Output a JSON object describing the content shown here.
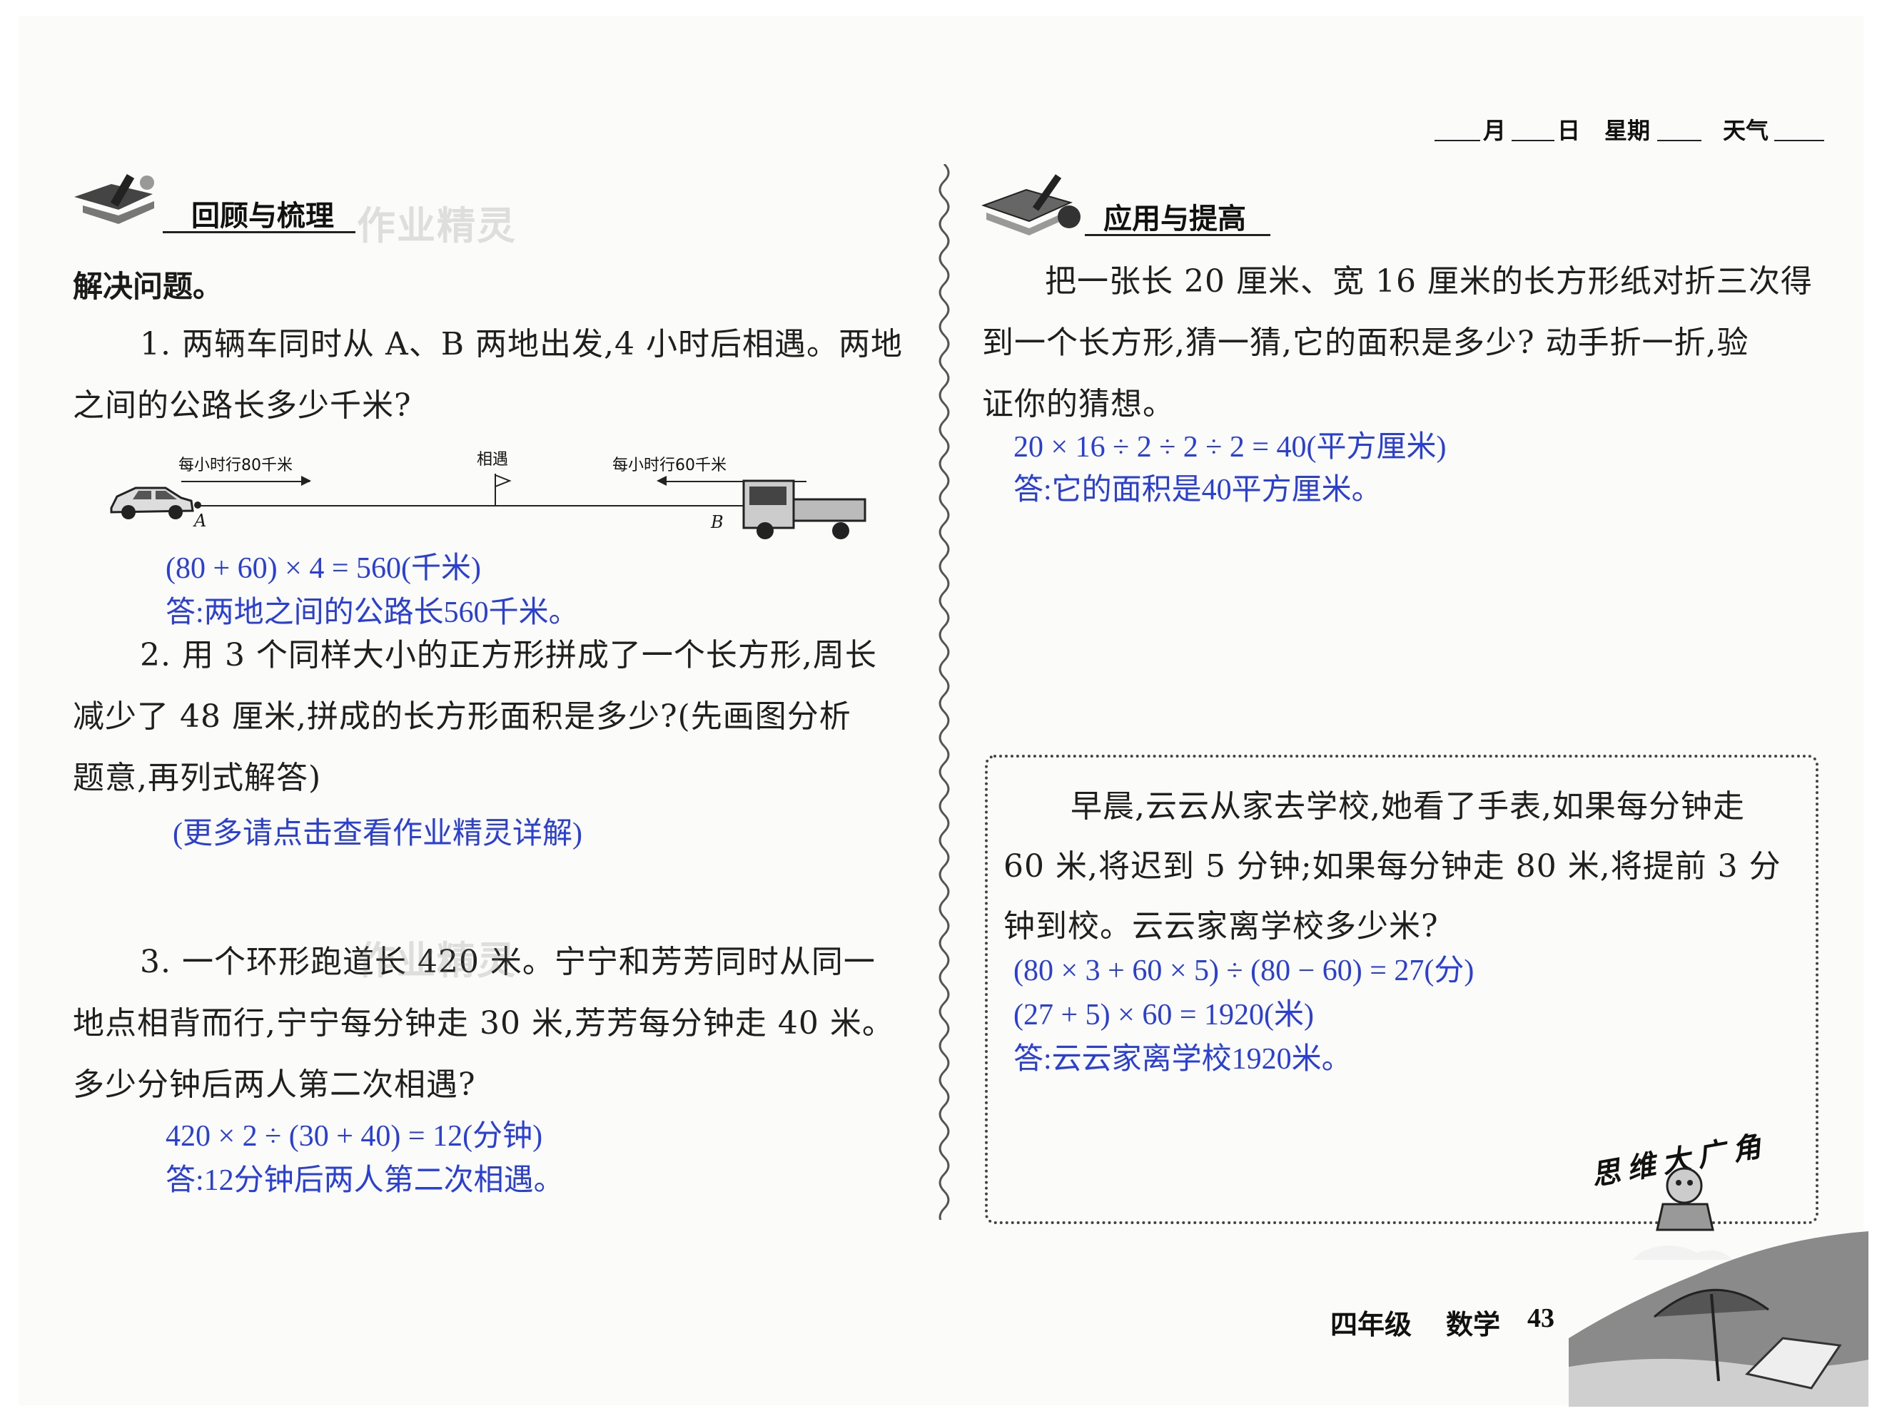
{
  "header": {
    "month": "月",
    "day": "日",
    "weekday": "星期",
    "weather": "天气"
  },
  "left": {
    "section_title": "回顾与梳理",
    "watermark": "作业精灵",
    "intro": "解决问题。",
    "q1": {
      "line1": "1. 两辆车同时从 A、B 两地出发,4 小时后相遇。两地",
      "line2": "之间的公路长多少千米?",
      "diagram": {
        "speed_a": "每小时行80千米",
        "meet": "相遇",
        "speed_b": "每小时行60千米",
        "point_a": "A",
        "point_b": "B"
      },
      "answer_line1": "(80 + 60) × 4 = 560(千米)",
      "answer_line2": "答:两地之间的公路长560千米。"
    },
    "q2": {
      "line1": "2. 用 3 个同样大小的正方形拼成了一个长方形,周长",
      "line2": "减少了 48 厘米,拼成的长方形面积是多少?(先画图分析",
      "line3": "题意,再列式解答)",
      "answer_line1": "(更多请点击查看作业精灵详解)"
    },
    "q3": {
      "line1": "3. 一个环形跑道长 420 米。宁宁和芳芳同时从同一",
      "line2": "地点相背而行,宁宁每分钟走 30 米,芳芳每分钟走 40 米。",
      "line3": "多少分钟后两人第二次相遇?",
      "answer_line1": "420 × 2 ÷ (30 + 40) = 12(分钟)",
      "answer_line2": "答:12分钟后两人第二次相遇。"
    }
  },
  "right": {
    "section_title": "应用与提高",
    "problem": {
      "line1": "把一张长 20 厘米、宽 16 厘米的长方形纸对折三次得",
      "line2": "到一个长方形,猜一猜,它的面积是多少? 动手折一折,验",
      "line3": "证你的猜想。",
      "answer_line1": "20 × 16 ÷ 2 ÷ 2 ÷ 2 = 40(平方厘米)",
      "answer_line2": "答:它的面积是40平方厘米。"
    },
    "box": {
      "line1": "早晨,云云从家去学校,她看了手表,如果每分钟走",
      "line2": "60 米,将迟到 5 分钟;如果每分钟走 80 米,将提前 3 分",
      "line3": "钟到校。云云家离学校多少米?",
      "answer_line1": "(80 × 3 + 60 × 5) ÷ (80 − 60) = 27(分)",
      "answer_line2": "(27 + 5) × 60 = 1920(米)",
      "answer_line3": "答:云云家离学校1920米。",
      "corner_title": "思维大广角"
    }
  },
  "footer": {
    "grade": "四年级",
    "subject": "数学",
    "page_number": "43"
  },
  "colors": {
    "answer_blue": "#2a3fd6",
    "text_black": "#1f1f1f"
  }
}
